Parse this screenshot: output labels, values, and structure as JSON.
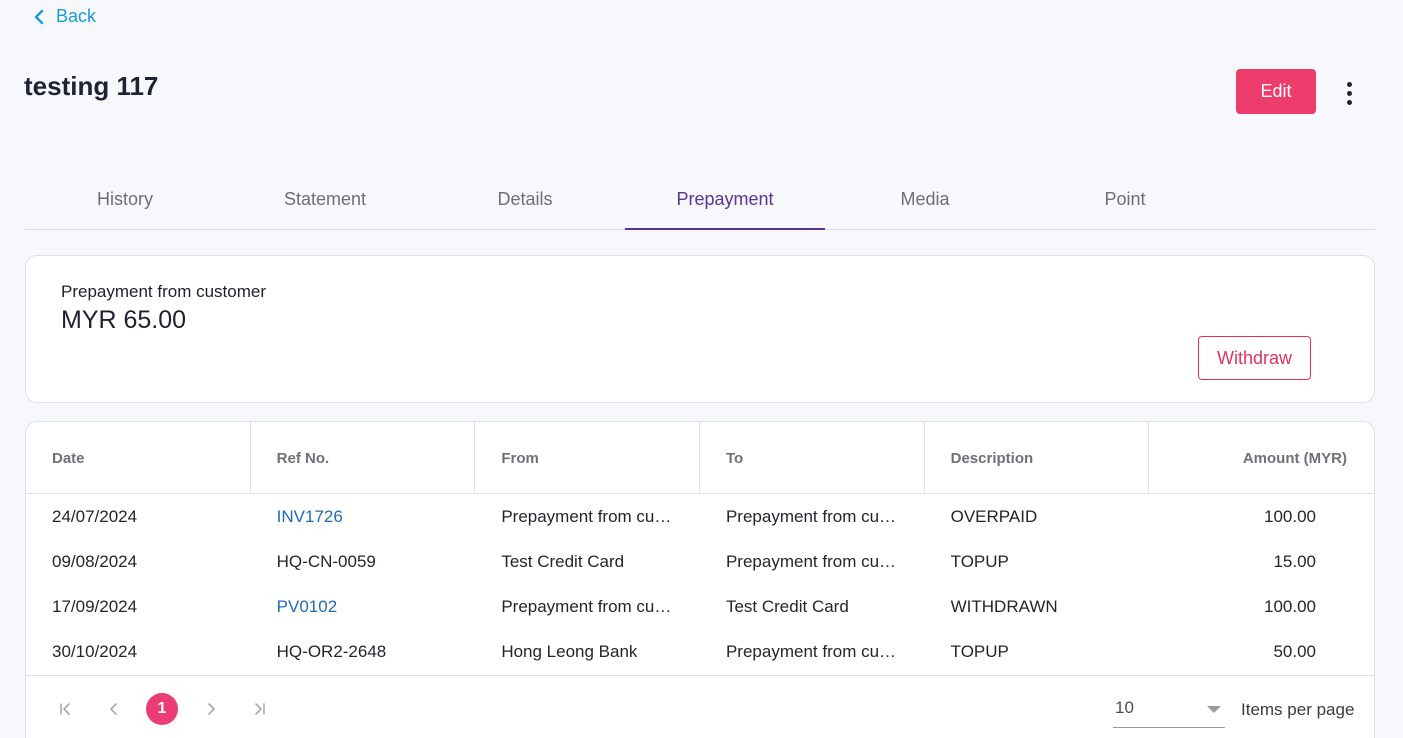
{
  "nav": {
    "back_label": "Back"
  },
  "header": {
    "title": "testing 117",
    "edit_label": "Edit"
  },
  "tabs": [
    {
      "label": "History",
      "active": false
    },
    {
      "label": "Statement",
      "active": false
    },
    {
      "label": "Details",
      "active": false
    },
    {
      "label": "Prepayment",
      "active": true
    },
    {
      "label": "Media",
      "active": false
    },
    {
      "label": "Point",
      "active": false
    }
  ],
  "summary": {
    "label": "Prepayment from customer",
    "amount": "MYR 65.00",
    "withdraw_label": "Withdraw"
  },
  "table": {
    "columns": [
      "Date",
      "Ref No.",
      "From",
      "To",
      "Description",
      "Amount (MYR)"
    ],
    "rows": [
      {
        "date": "24/07/2024",
        "ref": "INV1726",
        "ref_link": true,
        "from": "Prepayment from cust...",
        "to": "Prepayment from cust...",
        "description": "OVERPAID",
        "amount": "100.00"
      },
      {
        "date": "09/08/2024",
        "ref": "HQ-CN-0059",
        "ref_link": false,
        "from": "Test Credit Card",
        "to": "Prepayment from cust...",
        "description": "TOPUP",
        "amount": "15.00"
      },
      {
        "date": "17/09/2024",
        "ref": "PV0102",
        "ref_link": true,
        "from": "Prepayment from cust...",
        "to": "Test Credit Card",
        "description": "WITHDRAWN",
        "amount": "100.00"
      },
      {
        "date": "30/10/2024",
        "ref": "HQ-OR2-2648",
        "ref_link": false,
        "from": "Hong Leong Bank",
        "to": "Prepayment from cust...",
        "description": "TOPUP",
        "amount": "50.00"
      }
    ]
  },
  "pagination": {
    "current_page": "1",
    "per_page_value": "10",
    "per_page_label": "Items per page"
  },
  "colors": {
    "accent": "#ec3c6c",
    "active_tab": "#5a3592",
    "link": "#1f6cb4",
    "back": "#1a9bd7"
  }
}
